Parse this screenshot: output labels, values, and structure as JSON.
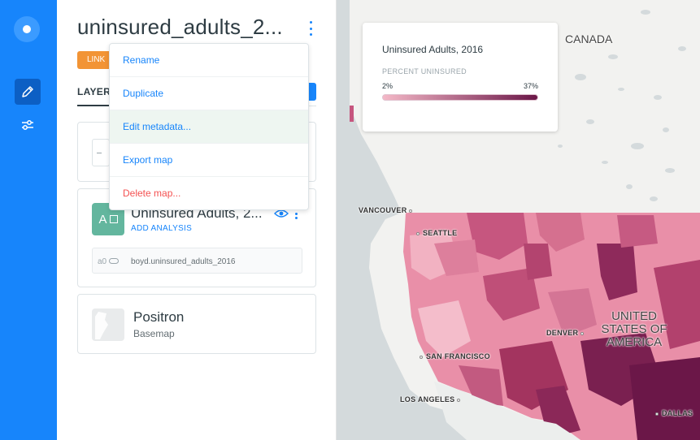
{
  "map": {
    "title": "uninsured_adults_2...",
    "privacy_label": "LINK",
    "accent_color": "#1785fb",
    "layer_color": "#63b69e"
  },
  "tabs": {
    "layers_label": "LAYERS"
  },
  "menu": {
    "items": [
      {
        "label": "Rename"
      },
      {
        "label": "Duplicate"
      },
      {
        "label": "Edit metadata..."
      },
      {
        "label": "Export map"
      },
      {
        "label": "Delete map..."
      }
    ]
  },
  "layer": {
    "letter": "A",
    "name": "Uninsured Adults, 2...",
    "add_analysis": "ADD ANALYSIS",
    "analysis_id": "a0",
    "source": "boyd.uninsured_adults_2016"
  },
  "basemap": {
    "name": "Positron",
    "type": "Basemap"
  },
  "legend": {
    "title": "Uninsured Adults, 2016",
    "subtitle": "PERCENT UNINSURED",
    "min": "2%",
    "max": "37%",
    "color_low": "#f4b8c7",
    "color_high": "#6b1748"
  },
  "map_labels": {
    "canada": "CANADA",
    "vancouver": "VANCOUVER",
    "seattle": "SEATTLE",
    "san_francisco": "SAN FRANCISCO",
    "los_angeles": "LOS ANGELES",
    "denver": "DENVER",
    "dallas": "DALLAS",
    "usa_line1": "UNITED",
    "usa_line2": "STATES OF",
    "usa_line3": "AMERICA"
  }
}
